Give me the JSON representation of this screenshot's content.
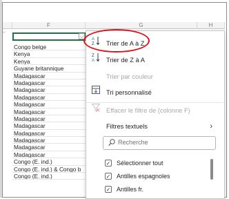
{
  "columns": {
    "f": "F",
    "g": "G",
    "h": "H"
  },
  "cells": [
    "Congo belge",
    "Kenya",
    "Kenya",
    "Guyane britannique",
    "Madagascar",
    "Madagascar",
    "Madagascar",
    "Madagascar",
    "Madagascar",
    "Madagascar",
    "Madagascar",
    "Madagascar",
    "Madagascar",
    "Madagascar",
    "Madagascar",
    "Madagascar",
    "Congo (E. ind.)",
    "Congo (E. ind.) & Congo b",
    "Congo (E. ind.)"
  ],
  "menu": {
    "sort_az": "Trier de A à Z",
    "sort_za": "Trier de Z à A",
    "sort_color": "Trier par couleur",
    "custom_sort": "Tri personnalisé",
    "clear_filter": "Effacer le filtre de (colonne F)",
    "text_filters": "Filtres textuels",
    "search_placeholder": "Recherche",
    "select_all": "Sélectionner tout",
    "items": [
      "Antilles espagnoles",
      "Antilles fr."
    ]
  },
  "colors": {
    "highlight": "#e0131a",
    "selection": "#1e7145"
  },
  "icons": [
    "sort-az-icon",
    "sort-za-icon",
    "custom-sort-icon",
    "clear-filter-icon",
    "search-icon",
    "chevron-right-icon",
    "checkbox-checked-icon"
  ]
}
